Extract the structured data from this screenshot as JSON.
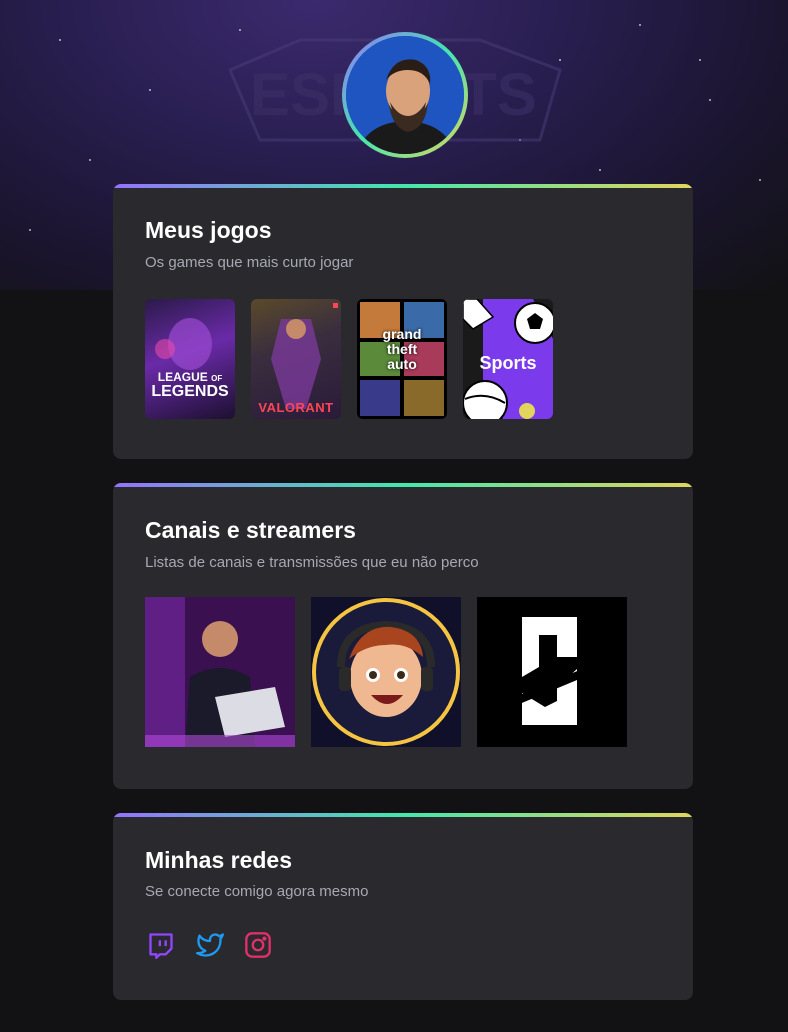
{
  "profile": {
    "avatar_icon": "profile-photo"
  },
  "sections": {
    "games": {
      "title": "Meus jogos",
      "subtitle": "Os games que mais curto jogar",
      "items": [
        {
          "label": "LEAGUE OF LEGENDS",
          "line1": "LEAGUE",
          "line2": "OF",
          "line3": "LEGENDS",
          "accent": "#6a2aa8"
        },
        {
          "label": "VALORANT",
          "accent": "#ff4655"
        },
        {
          "label": "grand theft auto",
          "line1": "grand",
          "line2": "theft",
          "line3": "auto",
          "accent": "#2d7a3a"
        },
        {
          "label": "Sports",
          "accent": "#7c3aed"
        }
      ]
    },
    "streamers": {
      "title": "Canais e streamers",
      "subtitle": "Listas de canais e transmissões que eu não perco",
      "items": [
        {
          "icon": "streamer-photo"
        },
        {
          "icon": "cartoon-avatar"
        },
        {
          "icon": "channel-logo"
        }
      ]
    },
    "networks": {
      "title": "Minhas redes",
      "subtitle": "Se conecte comigo agora mesmo",
      "items": [
        {
          "icon": "twitch-icon",
          "color": "#9146ff"
        },
        {
          "icon": "twitter-icon",
          "color": "#1d9bf0"
        },
        {
          "icon": "instagram-icon",
          "color": "#e1306c"
        }
      ]
    }
  }
}
